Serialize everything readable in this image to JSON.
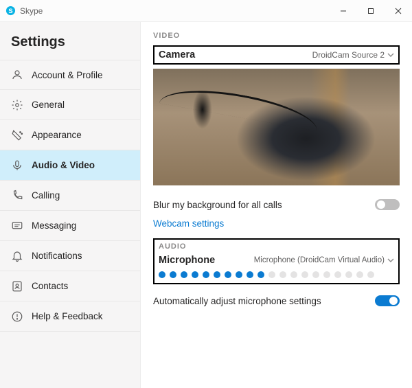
{
  "window": {
    "title": "Skype"
  },
  "sidebar": {
    "heading": "Settings",
    "items": [
      {
        "icon": "account-icon",
        "label": "Account & Profile",
        "active": false
      },
      {
        "icon": "gear-icon",
        "label": "General",
        "active": false
      },
      {
        "icon": "appearance-icon",
        "label": "Appearance",
        "active": false
      },
      {
        "icon": "microphone-icon",
        "label": "Audio & Video",
        "active": true
      },
      {
        "icon": "phone-icon",
        "label": "Calling",
        "active": false
      },
      {
        "icon": "message-icon",
        "label": "Messaging",
        "active": false
      },
      {
        "icon": "bell-icon",
        "label": "Notifications",
        "active": false
      },
      {
        "icon": "contacts-icon",
        "label": "Contacts",
        "active": false
      },
      {
        "icon": "help-icon",
        "label": "Help & Feedback",
        "active": false
      }
    ]
  },
  "video": {
    "section_label": "VIDEO",
    "camera_label": "Camera",
    "camera_selected": "DroidCam Source 2",
    "blur_label": "Blur my background for all calls",
    "blur_on": false,
    "webcam_link": "Webcam settings"
  },
  "audio": {
    "section_label": "AUDIO",
    "mic_label": "Microphone",
    "mic_selected": "Microphone (DroidCam Virtual Audio)",
    "level_filled": 10,
    "level_total": 20,
    "auto_adjust_label": "Automatically adjust microphone settings",
    "auto_adjust_on": true
  },
  "colors": {
    "accent": "#0b7bd1",
    "sidebar_active": "#d0eefb"
  }
}
